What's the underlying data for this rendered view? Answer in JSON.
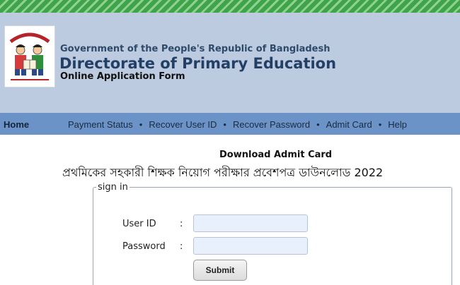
{
  "header": {
    "government": "Government of the People's Republic of Bangladesh",
    "directorate": "Directorate of Primary Education",
    "form_title": "Online Application Form",
    "logo_text_top": "সবার জন্য মানসম্মত শিক্ষা",
    "logo_text_bottom": "প্রাথমিক শিক্ষা অধিদপ্তর"
  },
  "nav": {
    "home": "Home",
    "links": [
      "Payment Status",
      "Recover User ID",
      "Recover Password",
      "Admit Card",
      "Help"
    ],
    "separator": "•"
  },
  "main": {
    "download_title": "Download Admit Card",
    "bangla_title": "প্রথমিকের সহকারী শিক্ষক নিয়োগ পরীক্ষার প্রবেশপত্র ডাউনলোড 2022",
    "signin_legend": "sign in",
    "user_id_label": "User ID",
    "password_label": "Password",
    "colon": ":",
    "user_id_value": "",
    "password_value": "",
    "submit_label": "Submit"
  },
  "colors": {
    "header_bg": "#bccbdf",
    "nav_bg": "#6b93c8",
    "stripe_green": "#3fa34a",
    "title_blue": "#243f66",
    "input_bg": "#e8f0fe"
  }
}
